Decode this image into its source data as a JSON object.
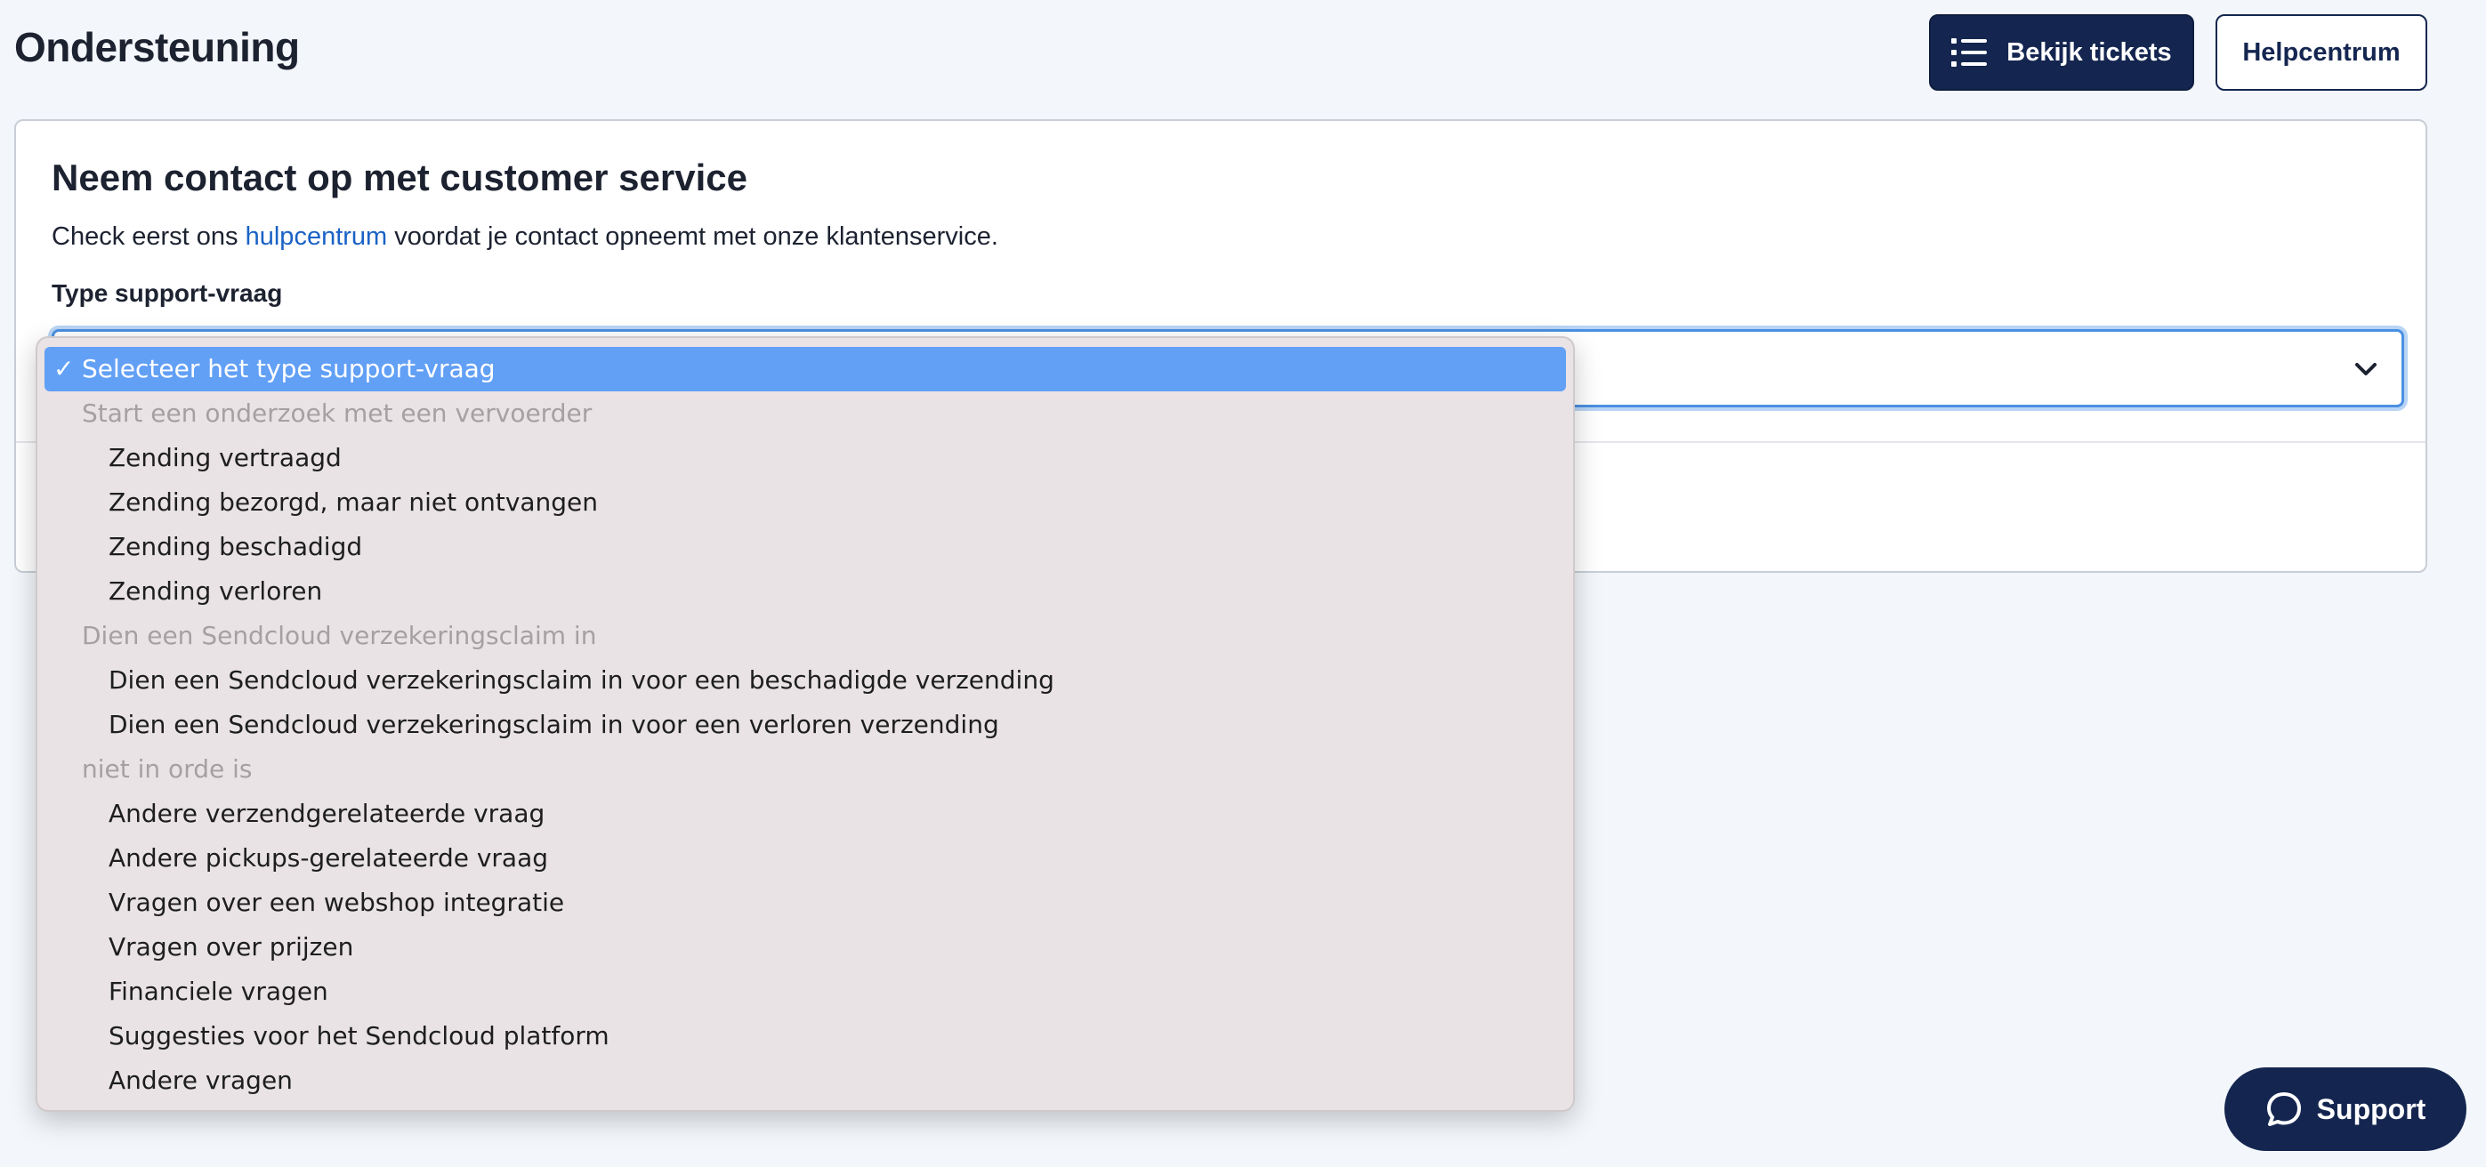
{
  "header": {
    "title": "Ondersteuning",
    "view_tickets_label": "Bekijk tickets",
    "help_center_label": "Helpcentrum"
  },
  "card": {
    "title": "Neem contact op met customer service",
    "text_before": "Check eerst ons ",
    "link_text": "hulpcentrum",
    "text_after": " voordat je contact opneemt met onze klantenservice.",
    "field_label": "Type support-vraag"
  },
  "dropdown": {
    "selected": "Selecteer het type support-vraag",
    "groups": [
      {
        "label": "Start een onderzoek met een vervoerder",
        "options": [
          "Zending vertraagd",
          "Zending bezorgd, maar niet ontvangen",
          "Zending beschadigd",
          "Zending verloren"
        ]
      },
      {
        "label": "Dien een Sendcloud verzekeringsclaim in",
        "options": [
          "Dien een Sendcloud verzekeringsclaim in voor een beschadigde verzending",
          "Dien een Sendcloud verzekeringsclaim in voor een verloren verzending"
        ]
      },
      {
        "label": "niet in orde is",
        "options": [
          "Andere verzendgerelateerde vraag",
          "Andere pickups-gerelateerde vraag",
          "Vragen over een webshop integratie",
          "Vragen over prijzen",
          "Financiele vragen",
          "Suggesties voor het Sendcloud platform",
          "Andere vragen"
        ]
      }
    ]
  },
  "support_button": {
    "label": "Support"
  },
  "icons": {
    "list": "list-icon",
    "chevron": "chevron-down-icon",
    "chat": "chat-bubble-icon",
    "check": "checkmark-icon"
  },
  "colors": {
    "primary": "#142650",
    "link": "#1a62c6",
    "focus": "#4a90e2",
    "highlight": "#62a0f6"
  }
}
